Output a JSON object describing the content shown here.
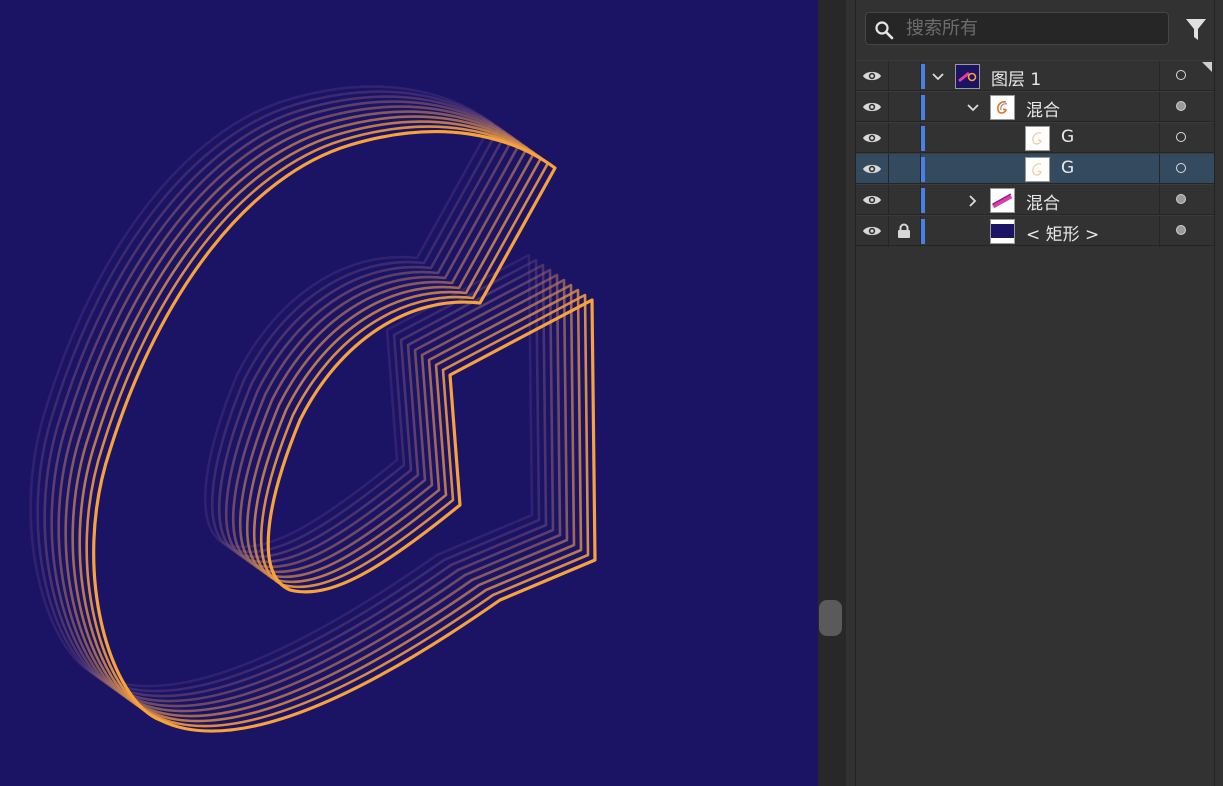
{
  "colors": {
    "canvas_bg": "#1b1363",
    "stroke_front": "#f7a23a",
    "stroke_back": "#5b3f8c",
    "selected_row": "#344a5e",
    "layer_color": "#4a7fe8"
  },
  "search": {
    "placeholder": "搜索所有",
    "value": "",
    "icon": "search-icon"
  },
  "filter": {
    "icon": "filter-icon"
  },
  "layers": [
    {
      "label": "图层 1",
      "level": 0,
      "expander": "expanded",
      "thumb": "layer-thumb",
      "locked": false,
      "visible": true,
      "target": "open",
      "selected": false
    },
    {
      "label": "混合",
      "level": 1,
      "expander": "expanded",
      "thumb": "blend-thumb",
      "locked": false,
      "visible": true,
      "target": "filled",
      "selected": false
    },
    {
      "label": "G",
      "level": 2,
      "expander": "none",
      "thumb": "g-thumb",
      "locked": false,
      "visible": true,
      "target": "open",
      "selected": false
    },
    {
      "label": "G",
      "level": 2,
      "expander": "none",
      "thumb": "g-thumb",
      "locked": false,
      "visible": true,
      "target": "open",
      "selected": true
    },
    {
      "label": "混合",
      "level": 1,
      "expander": "collapsed",
      "thumb": "blend2-thumb",
      "locked": false,
      "visible": true,
      "target": "filled",
      "selected": false
    },
    {
      "label": "< 矩形 >",
      "level": 1,
      "expander": "none",
      "thumb": "rect-thumb",
      "locked": true,
      "visible": true,
      "target": "filled",
      "selected": false
    }
  ]
}
